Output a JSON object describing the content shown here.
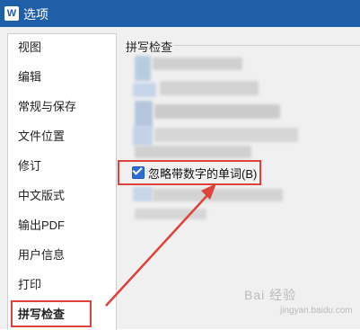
{
  "window": {
    "title": "选项",
    "app_icon_letter": "W"
  },
  "sidebar": {
    "items": [
      {
        "label": "视图"
      },
      {
        "label": "编辑"
      },
      {
        "label": "常规与保存"
      },
      {
        "label": "文件位置"
      },
      {
        "label": "修订"
      },
      {
        "label": "中文版式"
      },
      {
        "label": "输出PDF"
      },
      {
        "label": "用户信息"
      },
      {
        "label": "打印"
      },
      {
        "label": "拼写检查",
        "selected": true
      }
    ]
  },
  "main": {
    "section_title": "拼写检查",
    "ignore_numbers_checkbox": {
      "label": "忽略带数字的单词(B)",
      "checked": true
    }
  },
  "annotation": {
    "color": "#e0413a"
  },
  "watermark": {
    "text": "Bai 经验",
    "sub": "jingyan.baidu.com"
  }
}
